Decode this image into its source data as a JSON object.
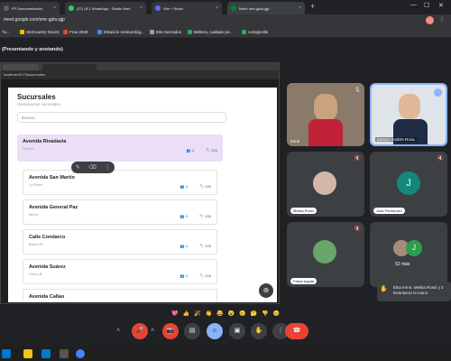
{
  "browser": {
    "tabs": [
      {
        "title": "FP Documentación",
        "color": "#5f6368"
      },
      {
        "title": "(27) ¡B-1 WhatsApp · Studio Web",
        "color": "#25d366"
      },
      {
        "title": "Vite + React",
        "color": "#646cff"
      },
      {
        "title": "Meet: smr-gptu-gjp",
        "color": "#00832d"
      }
    ],
    "address": "meet.google.com/smr-gptu-gjp",
    "bookmarks": [
      "Tu...",
      "StoCountry Nov24",
      "Frau 2048",
      "Estación meteorológ...",
      "Mis mercados",
      "Belleza, cuidado pe...",
      "compjeville"
    ]
  },
  "meet": {
    "title": "(Presentando y anotando)",
    "share": {
      "address": "localhost:5173/sucursales",
      "app_title": "Sucursales",
      "app_subtitle": "Gestiona tus sucursales",
      "search_placeholder": "Buscar...",
      "selected": {
        "name": "Avenida Rivadavia",
        "location": "Centro",
        "count": "4",
        "tag": "100"
      },
      "branches": [
        {
          "name": "Avenida San Martín",
          "location": "La Plata",
          "count": "4",
          "tag": "100"
        },
        {
          "name": "Avenida General Paz",
          "location": "Merlo",
          "count": "0",
          "tag": "100"
        },
        {
          "name": "Calle Condarco",
          "location": "Bahía Fe",
          "count": "4",
          "tag": "100"
        },
        {
          "name": "Avenida Suárez",
          "location": "Fleixs-B",
          "count": "4",
          "tag": "100"
        },
        {
          "name": "Avenida Callao",
          "location": "",
          "count": "",
          "tag": ""
        }
      ]
    },
    "participants": [
      {
        "name": "Irene"
      },
      {
        "name": "Ignacio Andrés Roca"
      },
      {
        "name": "Melisa Rossi"
      },
      {
        "name": "Juan Fernández",
        "initial": "J"
      },
      {
        "name": "Felipe Aguiar"
      },
      {
        "name": "52 más",
        "initial": "J"
      }
    ],
    "raised_hands": "Elsa Irene, Melisa Rossi y 3 levantaron la mano",
    "reactions": [
      "💖",
      "👍",
      "🎉",
      "👏",
      "😂",
      "😮",
      "😢",
      "🤔",
      "👎",
      "😊"
    ]
  },
  "icons": {
    "mic_off": "mic-off-icon",
    "camera_off": "camera-off-icon",
    "captions": "captions-icon",
    "emoji": "emoji-icon",
    "present": "present-icon",
    "raise_hand": "hand-icon",
    "more": "more-icon",
    "hangup": "hangup-icon"
  }
}
